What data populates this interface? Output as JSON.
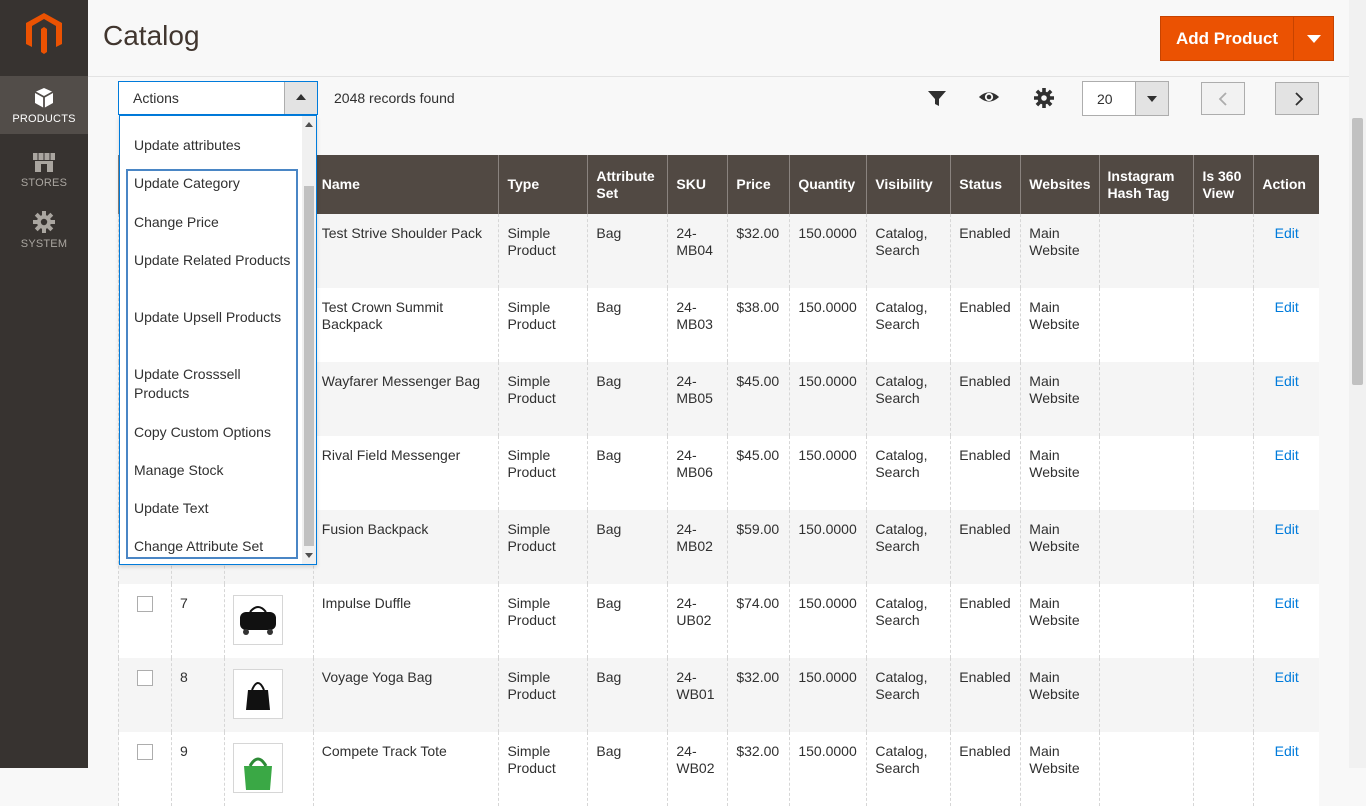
{
  "sidebar": {
    "items": [
      {
        "label": "PRODUCTS",
        "icon": "box-icon",
        "active": true
      },
      {
        "label": "STORES",
        "icon": "store-icon",
        "active": false
      },
      {
        "label": "SYSTEM",
        "icon": "gear-icon",
        "active": false
      }
    ]
  },
  "header": {
    "title": "Catalog",
    "add_button": "Add Product"
  },
  "toolbar": {
    "actions_label": "Actions",
    "records_found": "2048 records found",
    "per_page": "20"
  },
  "actions_menu": {
    "items": [
      "Update attributes",
      "Update Category",
      "Change Price",
      "Update Related Products",
      "Update Upsell Products",
      "Update Crosssell Products",
      "Copy Custom Options",
      "Manage Stock",
      "Update Text",
      "Change Attribute Set"
    ]
  },
  "grid": {
    "columns": [
      "Name",
      "Type",
      "Attribute Set",
      "SKU",
      "Price",
      "Quantity",
      "Visibility",
      "Status",
      "Websites",
      "Instagram Hash Tag",
      "Is 360 View",
      "Action"
    ],
    "rows": [
      {
        "id": "",
        "name": "Test Strive Shoulder Pack",
        "type": "Simple Product",
        "attr_set": "Bag",
        "sku": "24-MB04",
        "price": "$32.00",
        "qty": "150.0000",
        "visibility": "Catalog, Search",
        "status": "Enabled",
        "websites": "Main Website",
        "action": "Edit"
      },
      {
        "id": "",
        "name": "Test Crown Summit Backpack",
        "type": "Simple Product",
        "attr_set": "Bag",
        "sku": "24-MB03",
        "price": "$38.00",
        "qty": "150.0000",
        "visibility": "Catalog, Search",
        "status": "Enabled",
        "websites": "Main Website",
        "action": "Edit"
      },
      {
        "id": "",
        "name": "Wayfarer Messenger Bag",
        "type": "Simple Product",
        "attr_set": "Bag",
        "sku": "24-MB05",
        "price": "$45.00",
        "qty": "150.0000",
        "visibility": "Catalog, Search",
        "status": "Enabled",
        "websites": "Main Website",
        "action": "Edit"
      },
      {
        "id": "",
        "name": "Rival Field Messenger",
        "type": "Simple Product",
        "attr_set": "Bag",
        "sku": "24-MB06",
        "price": "$45.00",
        "qty": "150.0000",
        "visibility": "Catalog, Search",
        "status": "Enabled",
        "websites": "Main Website",
        "action": "Edit"
      },
      {
        "id": "",
        "name": "Fusion Backpack",
        "type": "Simple Product",
        "attr_set": "Bag",
        "sku": "24-MB02",
        "price": "$59.00",
        "qty": "150.0000",
        "visibility": "Catalog, Search",
        "status": "Enabled",
        "websites": "Main Website",
        "action": "Edit"
      },
      {
        "id": "7",
        "name": "Impulse Duffle",
        "type": "Simple Product",
        "attr_set": "Bag",
        "sku": "24-UB02",
        "price": "$74.00",
        "qty": "150.0000",
        "visibility": "Catalog, Search",
        "status": "Enabled",
        "websites": "Main Website",
        "action": "Edit"
      },
      {
        "id": "8",
        "name": "Voyage Yoga Bag",
        "type": "Simple Product",
        "attr_set": "Bag",
        "sku": "24-WB01",
        "price": "$32.00",
        "qty": "150.0000",
        "visibility": "Catalog, Search",
        "status": "Enabled",
        "websites": "Main Website",
        "action": "Edit"
      },
      {
        "id": "9",
        "name": "Compete Track Tote",
        "type": "Simple Product",
        "attr_set": "Bag",
        "sku": "24-WB02",
        "price": "$32.00",
        "qty": "150.0000",
        "visibility": "Catalog, Search",
        "status": "Enabled",
        "websites": "Main Website",
        "action": "Edit"
      }
    ]
  },
  "colors": {
    "accent": "#eb5202",
    "sidebar": "#373330",
    "header_row": "#514943",
    "link": "#007bdb"
  }
}
